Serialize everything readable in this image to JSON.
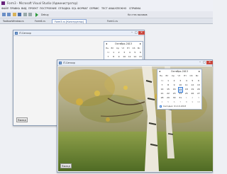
{
  "vs": {
    "title": "Form3 - Microsoft Visual Studio (Администратор)",
    "menu": [
      "ФАЙЛ",
      "ПРАВКА",
      "ВИД",
      "ПРОЕКТ",
      "ПОСТРОЕНИЕ",
      "ОТЛАДКА",
      "SQL",
      "ФОРМАТ",
      "СЕРВИС",
      "ТЕСТ",
      "ANALYZE",
      "ОКНО",
      "СПРАВКА"
    ],
    "toolbar_hint": "Debug",
    "toolbar_right": "Ка стек вызовов",
    "tabs": [
      "ToolboxWindow.cs",
      "Form6.cs",
      "Form3.cs [Конструктор]",
      "Form1.cs"
    ]
  },
  "form_small": {
    "title": "IT-Сенсор",
    "button": "Выход",
    "calendar": {
      "month": "Октябрь 2013",
      "dow": [
        "Пн",
        "Вт",
        "Ср",
        "Чт",
        "Пт",
        "Сб",
        "Вс"
      ],
      "weeks": [
        [
          "30",
          "1",
          "2",
          "3",
          "4",
          "5",
          "6"
        ],
        [
          "7",
          "8",
          "9",
          "10",
          "11",
          "12",
          "13"
        ],
        [
          "14",
          "15",
          "16",
          "17",
          "18",
          "19",
          "20"
        ],
        [
          "21",
          "22",
          "23",
          "24",
          "25",
          "26",
          "27"
        ],
        [
          "28",
          "29",
          "30",
          "31",
          "1",
          "2",
          "3"
        ],
        [
          "4",
          "5",
          "6",
          "7",
          "8",
          "9",
          "10"
        ]
      ],
      "selected": "17"
    }
  },
  "form_big": {
    "title": "IT-Сенсор",
    "button": "Выход",
    "calendar": {
      "month": "Октябрь 2013",
      "dow": [
        "Пн",
        "Вт",
        "Ср",
        "Чт",
        "Пт",
        "Сб",
        "Вс"
      ],
      "weeks": [
        [
          "30",
          "1",
          "2",
          "3",
          "4",
          "5",
          "6"
        ],
        [
          "7",
          "8",
          "9",
          "10",
          "11",
          "12",
          "13"
        ],
        [
          "14",
          "15",
          "16",
          "17",
          "18",
          "19",
          "20"
        ],
        [
          "21",
          "22",
          "23",
          "24",
          "25",
          "26",
          "27"
        ],
        [
          "28",
          "29",
          "30",
          "31",
          "1",
          "2",
          "3"
        ],
        [
          "4",
          "5",
          "6",
          "7",
          "8",
          "9",
          "10"
        ]
      ],
      "selected": "17",
      "today": "Сегодня: 01.10.2013"
    }
  },
  "colors": {
    "accent": "#3c7fd6",
    "close": "#c9453b"
  }
}
